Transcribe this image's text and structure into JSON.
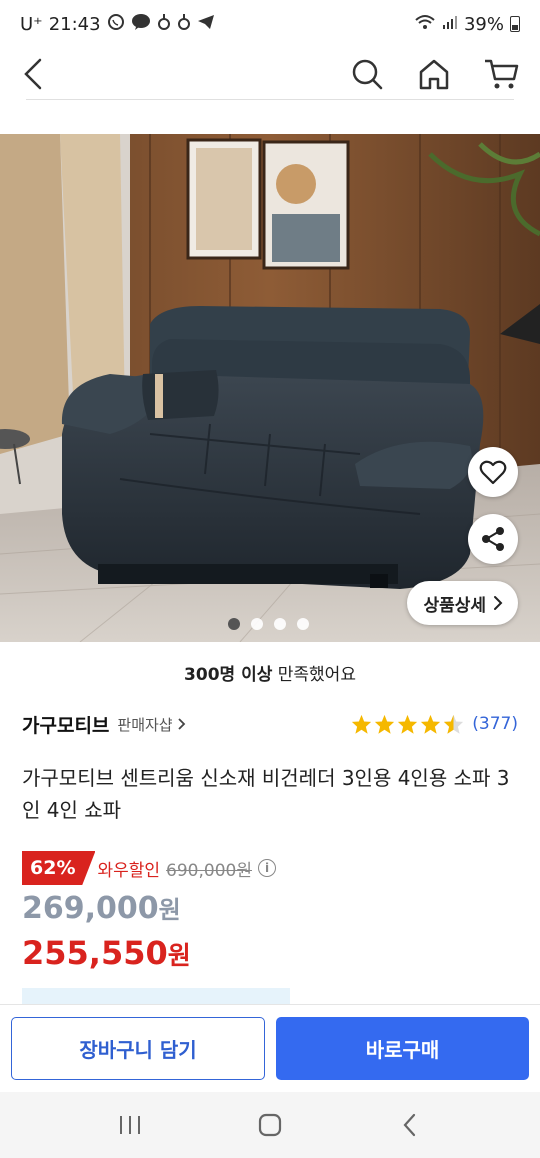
{
  "status_bar": {
    "carrier": "U⁺",
    "time": "21:43",
    "battery": "39%",
    "icons": [
      "whatsapp-icon",
      "kakaotalk-icon",
      "notification-icon",
      "notification-icon",
      "telegram-icon",
      "wifi-icon",
      "signal-icon",
      "battery-icon"
    ]
  },
  "header": {
    "icons": [
      "back-icon",
      "search-icon",
      "home-icon",
      "cart-icon"
    ]
  },
  "hero": {
    "detail_label": "상품상세",
    "image_count": 4,
    "active_index": 0,
    "icons": [
      "heart-icon",
      "share-icon",
      "chevron-right-icon"
    ]
  },
  "satisfaction": {
    "highlight": "300명 이상",
    "rest": " 만족했어요"
  },
  "seller": {
    "name": "가구모티브",
    "link_label": "판매자샵",
    "rating": 4.5,
    "review_count": "(377)"
  },
  "product": {
    "title": "가구모티브 센트리움 신소재 비건레더 3인용 4인용 소파 3인 4인 쇼파"
  },
  "price": {
    "discount": "62%",
    "wow_label": "와우할인",
    "original": "690,000원",
    "coupang_value": "269,000",
    "wow_value": "255,550",
    "unit": "원"
  },
  "actions": {
    "cart_label": "장바구니 담기",
    "buy_label": "바로구매"
  },
  "colors": {
    "accent_blue": "#346af0",
    "sale_red": "#d9231e",
    "star_yellow": "#f5b800"
  },
  "nav": {
    "icons": [
      "recent-apps-icon",
      "home-circle-icon",
      "back-nav-icon"
    ]
  }
}
